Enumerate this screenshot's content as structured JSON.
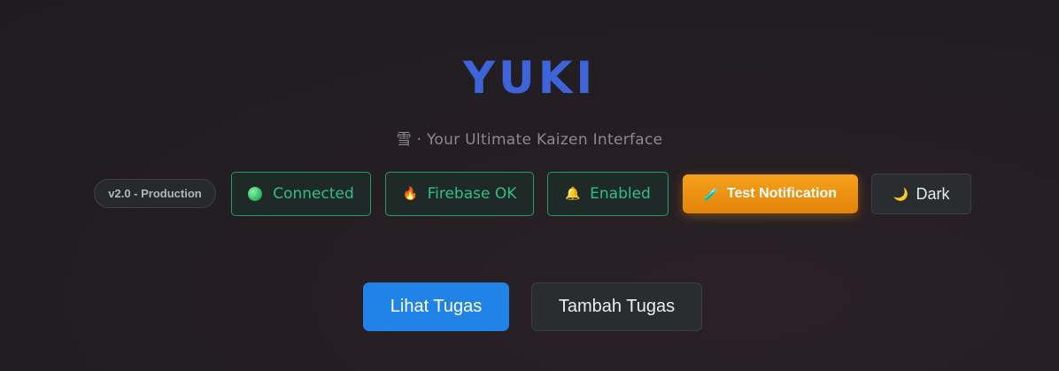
{
  "header": {
    "title": "YUKI",
    "subtitle": "雪 · Your Ultimate Kaizen Interface"
  },
  "status": {
    "version_badge": "v2.0 - Production",
    "connection": {
      "label": "Connected",
      "icon": "green-dot-icon"
    },
    "firebase": {
      "label": "Firebase OK",
      "icon": "fire-icon",
      "glyph": "🔥"
    },
    "notifications": {
      "label": "Enabled",
      "icon": "bell-icon",
      "glyph": "🔔"
    }
  },
  "actions": {
    "test_notification": {
      "label": "Test Notification",
      "icon": "test-tube-icon",
      "glyph": "🧪"
    },
    "theme_toggle": {
      "label": "Dark",
      "icon": "moon-icon",
      "glyph": "🌙"
    }
  },
  "main": {
    "view_tasks_label": "Lihat Tugas",
    "add_task_label": "Tambah Tugas"
  },
  "colors": {
    "title": "#3f63d8",
    "success": "#2fbf84",
    "warning": "#f4a21a",
    "primary": "#2283e6",
    "background": "#241e22"
  }
}
